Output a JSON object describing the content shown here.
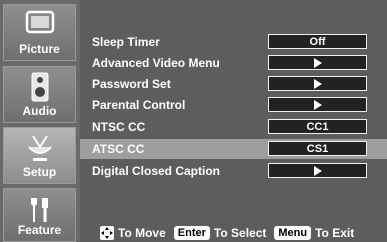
{
  "sidebar": {
    "tabs": [
      {
        "label": "Picture"
      },
      {
        "label": "Audio"
      },
      {
        "label": "Setup"
      },
      {
        "label": "Feature"
      }
    ]
  },
  "menu": {
    "items": [
      {
        "label": "Sleep Timer",
        "value": "Off"
      },
      {
        "label": "Advanced Video Menu",
        "value": ""
      },
      {
        "label": "Password Set",
        "value": ""
      },
      {
        "label": "Parental Control",
        "value": ""
      },
      {
        "label": "NTSC CC",
        "value": "CC1"
      },
      {
        "label": "ATSC CC",
        "value": "CS1"
      },
      {
        "label": "Digital Closed Caption",
        "value": ""
      }
    ]
  },
  "hint": {
    "move": "To Move",
    "enter_key": "Enter",
    "select": "To Select",
    "menu_key": "Menu",
    "exit": "To Exit"
  },
  "colors": {
    "background": "#5d5d5d",
    "highlight": "#9e9e9e",
    "value_box": "#222222"
  }
}
